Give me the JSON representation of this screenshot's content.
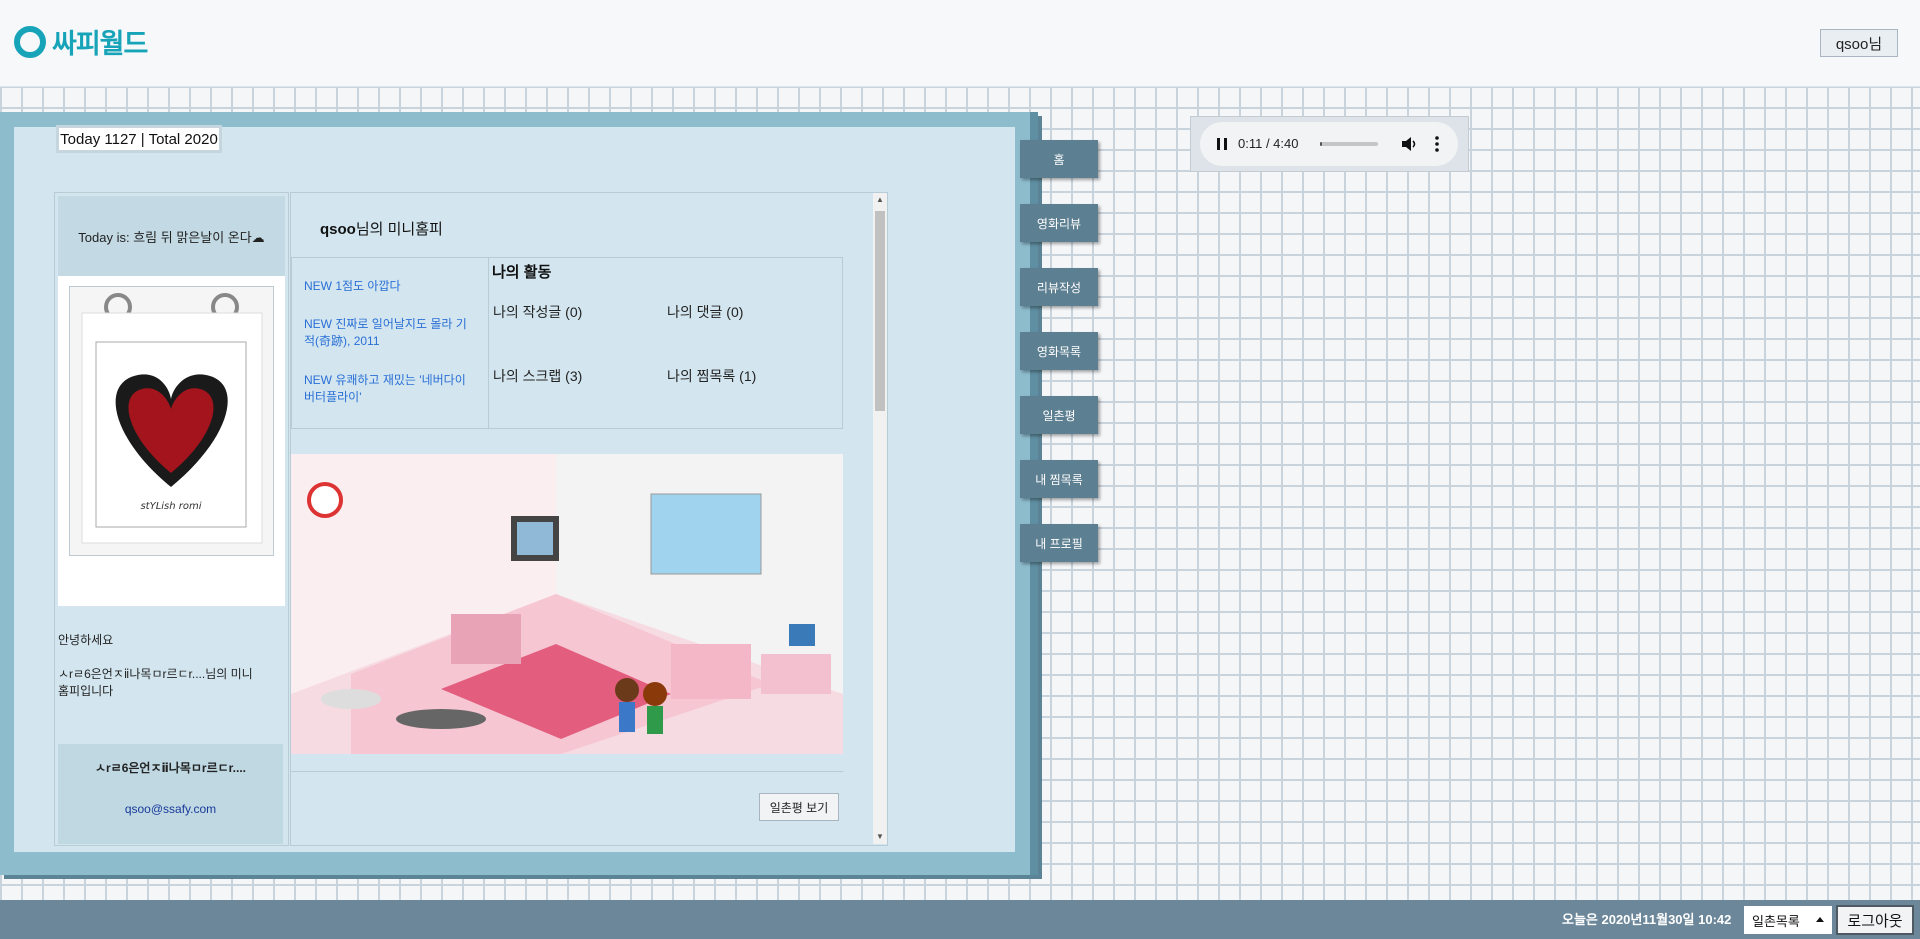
{
  "header": {
    "logo_text": "싸피월드",
    "user_label": "qsoo님"
  },
  "counter": {
    "text": "Today 1127 | Total 2020"
  },
  "profile": {
    "today_is": "Today is: 흐림 뒤 맑은날이 온다☁",
    "greeting": "안녕하세요",
    "intro": "ㅅrㄹ6은언ㅈⅱ나목ㅁr르ㄷr....님의 미니홈피입니다",
    "name": "ㅅrㄹ6은언ㅈⅱ나목ㅁr르ㄷr....",
    "email": "qsoo@ssafy.com"
  },
  "home": {
    "owner": "qsoo",
    "title_suffix": "님의 미니홈피",
    "news": [
      "NEW 1점도 아깝다",
      "NEW 진짜로 일어날지도 몰라 기적(奇跡), 2011",
      "NEW 유쾌하고 재밌는 '네버다이 버터플라이'"
    ],
    "activity_title": "나의 활동",
    "activity": {
      "posts": "나의 작성글 (0)",
      "comments": "나의 댓글 (0)",
      "scraps": "나의 스크랩 (3)",
      "wishlist": "나의 찜목록 (1)"
    },
    "review_button": "일촌평 보기"
  },
  "nav": [
    "홈",
    "영화리뷰",
    "리뷰작성",
    "영화목록",
    "일촌평",
    "내 찜목록",
    "내 프로필"
  ],
  "player": {
    "time": "0:11 / 4:40",
    "progress": 0.04
  },
  "footer": {
    "date_text": "오늘은 2020년11월30일 10:42",
    "select_value": "일촌목록",
    "logout": "로그아웃"
  },
  "colors": {
    "accent": "#18a4b8",
    "nav_bg": "#5d7f92",
    "footer_bg": "#6b8799",
    "link": "#2a6fd6"
  },
  "icons": {
    "play_state": "pause-icon",
    "volume": "volume-icon",
    "more": "more-vert-icon"
  }
}
